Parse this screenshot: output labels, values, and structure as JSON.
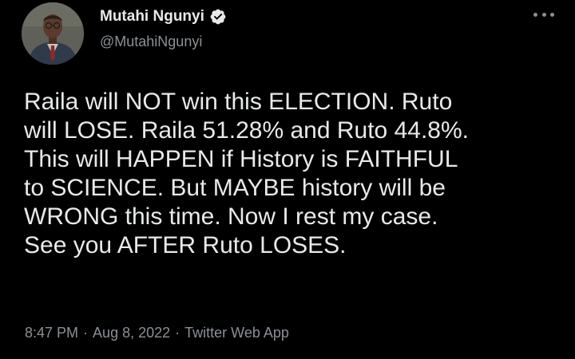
{
  "author": {
    "display_name": "Mutahi Ngunyi",
    "handle": "@MutahiNgunyi",
    "verified_icon": "verified-badge-icon",
    "avatar_icon": "profile-photo"
  },
  "tweet": {
    "text": "Raila will NOT win this ELECTION. Ruto\nwill LOSE. Raila 51.28% and Ruto 44.8%.\nThis will HAPPEN if History is FAITHFUL\nto SCIENCE. But MAYBE history will be\nWRONG this time. Now I rest my case.\nSee you AFTER Ruto LOSES."
  },
  "meta": {
    "time": "8:47 PM",
    "separator": "·",
    "date": "Aug 8, 2022",
    "source": "Twitter Web App"
  },
  "menu": {
    "icon": "more-options-icon"
  },
  "colors": {
    "background": "#000000",
    "primary_text": "#e7e9ea",
    "secondary_text": "#8b9096"
  }
}
